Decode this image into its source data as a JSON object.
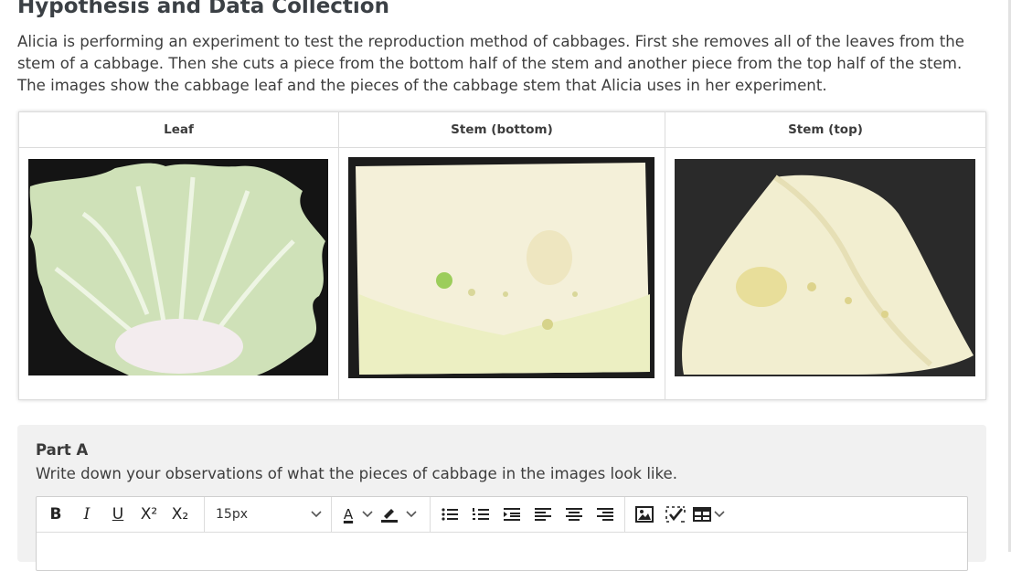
{
  "page": {
    "title": "Hypothesis and Data Collection",
    "intro": "Alicia is performing an experiment to test the reproduction method of cabbages. First she removes all of the leaves from the stem of a cabbage. Then she cuts a piece from the bottom half of the stem and another piece from the top half of the stem. The images show the cabbage leaf and the pieces of the cabbage stem that Alicia uses in her experiment."
  },
  "image_table": {
    "headers": [
      "Leaf",
      "Stem (bottom)",
      "Stem (top)"
    ],
    "images": [
      "cabbage leaf photo",
      "cabbage stem bottom photo",
      "cabbage stem top photo"
    ]
  },
  "partA": {
    "title": "Part A",
    "prompt": "Write down your observations of what the pieces of cabbage in the images look like.",
    "toolbar": {
      "font_size": "15px",
      "buttons": [
        "bold-icon",
        "italic-icon",
        "underline-icon",
        "superscript-icon",
        "subscript-icon",
        "font-size-select",
        "text-color-icon",
        "highlight-icon",
        "bullet-list-icon",
        "numbered-list-icon",
        "indent-icon",
        "align-left-icon",
        "align-center-icon",
        "align-right-icon",
        "image-icon",
        "spellcheck-icon",
        "table-icon"
      ]
    }
  },
  "colors": {
    "heading": "#3b4045",
    "panel_bg": "#f1f1f1",
    "border": "#dcdcdc"
  }
}
